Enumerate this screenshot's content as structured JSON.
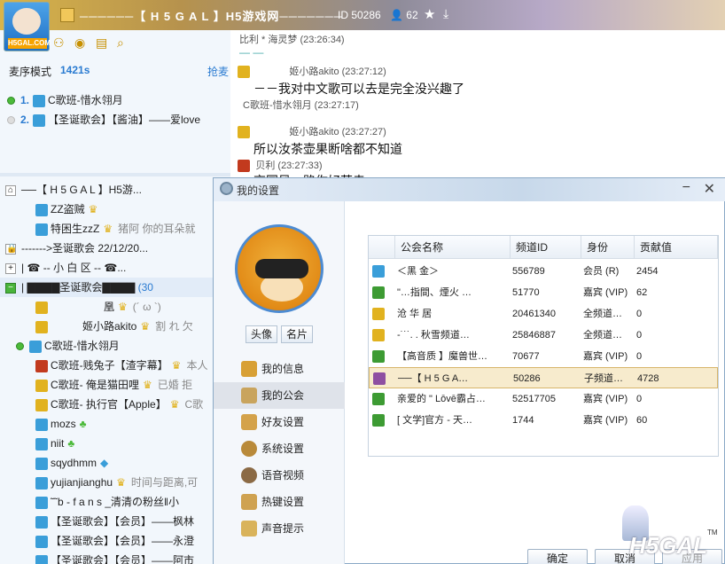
{
  "topbar": {
    "title": "──────【 H 5 G A L 】H5游戏网───────",
    "channel_id": "ID 50286",
    "online": "62",
    "logo_text": "H5GAL.COM"
  },
  "queue": {
    "mode_label": "麦序模式",
    "time": "1421s",
    "grab_label": "抢麦",
    "items": [
      {
        "num": "1.",
        "name": "C歌班-惜水翎月"
      },
      {
        "num": "2.",
        "name": "【圣诞歌会】【酱油】——爱love"
      }
    ]
  },
  "chat": {
    "messages": [
      {
        "meta": "比利 * 海灵梦  (23:26:34)",
        "text": "— —"
      },
      {
        "meta": "姬小路akito  (23:27:12)",
        "text": "－－我对中文歌可以去是完全没兴趣了",
        "sub": "C歌班-惜水翎月  (23:27:17)"
      },
      {
        "meta": "姬小路akito  (23:27:27)",
        "text": "所以汝茶壶果断啥都不知道"
      },
      {
        "meta": "贝利  (23:27:33)",
        "text": "京国风一路你好莫寺"
      }
    ]
  },
  "tree": {
    "rows": [
      {
        "text": "──【 H 5 G A L 】H5游..."
      },
      {
        "text": "ZZ盗贼"
      },
      {
        "text": "特困生zzZ",
        "extra": "猪阿  你的耳朵就"
      },
      {
        "text": "------->圣诞歌会 22/12/20..."
      },
      {
        "text": "|    ☎ -- 小 白 区 -- ☎..."
      },
      {
        "text": "|  ▇▇▇▇圣诞歌会▇▇▇▇",
        "count": "(30"
      },
      {
        "text": "凰",
        "extra": "(´ ω `)"
      },
      {
        "text": "姬小路akito",
        "extra": "割 れ 欠"
      },
      {
        "text": "C歌班-惜水翎月"
      },
      {
        "text": "C歌班-贱兔子【渣字幕】",
        "extra": "本人"
      },
      {
        "text": "C歌班- 俺是猫田哩",
        "extra": "已婚 拒"
      },
      {
        "text": "C歌班- 执行官【Apple】",
        "extra": "C歌"
      },
      {
        "text": "mozs"
      },
      {
        "text": "niit"
      },
      {
        "text": "sqydhmm"
      },
      {
        "text": "yujianjianghu",
        "extra": "时间与距离,可"
      },
      {
        "text": "˜˜b - f a n s _清清の粉丝‖小"
      },
      {
        "text": "【圣诞歌会】【会员】——枫林"
      },
      {
        "text": "【圣诞歌会】【会员】——永澄"
      },
      {
        "text": "【圣诞歌会】【会员】——阿市"
      }
    ]
  },
  "dialog": {
    "title": "我的设置",
    "btn_avatar": "头像",
    "btn_card": "名片",
    "menu": [
      "我的信息",
      "我的公会",
      "好友设置",
      "系统设置",
      "语音视频",
      "热键设置",
      "声音提示"
    ],
    "columns": [
      "公会名称",
      "频道ID",
      "身份",
      "贡献值"
    ],
    "rows": [
      {
        "name": "＜黑 金＞",
        "id": "556789",
        "role": "会员 (R)",
        "score": "2454"
      },
      {
        "name": "\"…指間、煙火    …",
        "id": "51770",
        "role": "嘉宾 (VIP)",
        "score": "62"
      },
      {
        "name": "沧 华 居",
        "id": "20461340",
        "role": "全频道…",
        "score": "0"
      },
      {
        "name": "-˙˙˙. .   秋雪频道…",
        "id": "25846887",
        "role": "全频道…",
        "score": "0"
      },
      {
        "name": "【高音质  】魔兽世…",
        "id": "70677",
        "role": "嘉宾 (VIP)",
        "score": "0"
      },
      {
        "name": "──【 H 5 G A…",
        "id": "50286",
        "role": "子频道…",
        "score": "4728"
      },
      {
        "name": "亲爱的 \" Lōvē霸占…",
        "id": "52517705",
        "role": "嘉宾 (VIP)",
        "score": "0"
      },
      {
        "name": "[     文学]官方 - 天…",
        "id": "1744",
        "role": "嘉宾 (VIP)",
        "score": "60"
      }
    ],
    "ok": "确定",
    "cancel": "取消",
    "apply": "应用"
  },
  "watermark": "H5GAL",
  "colors": {
    "accent": "#2a7bd1",
    "selected_row": "#f7ebcd",
    "brand_gold": "#e1b21f"
  }
}
